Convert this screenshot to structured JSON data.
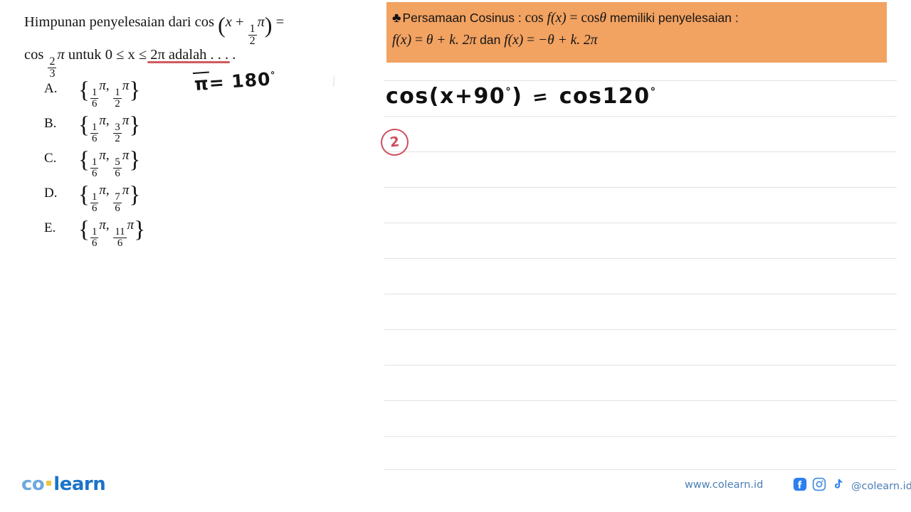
{
  "question": {
    "line1_prefix": "Himpunan penyelesaian dari",
    "cos_label": "cos",
    "var_x": "x",
    "plus": "+",
    "half_num": "1",
    "half_den": "2",
    "pi": "π",
    "equals": "=",
    "line2_cos": "cos",
    "twothirds_num": "2",
    "twothirds_den": "3",
    "untuk": "untuk",
    "domain_text": "0 ≤ x ≤ 2π",
    "adalah": "adalah",
    "ellipsis": ". . . .",
    "underline_color": "#cf5b61"
  },
  "options": [
    {
      "letter": "A.",
      "first_num": "1",
      "first_den": "6",
      "second_num": "1",
      "second_den": "2"
    },
    {
      "letter": "B.",
      "first_num": "1",
      "first_den": "6",
      "second_num": "3",
      "second_den": "2"
    },
    {
      "letter": "C.",
      "first_num": "1",
      "first_den": "6",
      "second_num": "5",
      "second_den": "6"
    },
    {
      "letter": "D.",
      "first_num": "1",
      "first_den": "6",
      "second_num": "7",
      "second_den": "6"
    },
    {
      "letter": "E.",
      "first_num": "1",
      "first_den": "6",
      "second_num": "11",
      "second_den": "6"
    }
  ],
  "annotations": {
    "pi_conversion_pi": "π",
    "pi_conversion_rest": "= 180",
    "pi_conversion_deg": "°",
    "faint_mark": "/"
  },
  "formula_box": {
    "bullet": "♣",
    "title": "Persamaan Cosinus :",
    "cos1": "cos",
    "fx1": "f(x)",
    "eq1": "=",
    "cos2": "cos",
    "theta": "θ",
    "tail": "memiliki penyelesaian :",
    "sol1_fx": "f(x)",
    "sol1_eq": "=",
    "sol1_body": "θ + k. 2π",
    "dan": "dan",
    "sol2_fx": "f(x)",
    "sol2_eq": "=",
    "sol2_body": "−θ + k. 2π",
    "bg_color": "#f2a261"
  },
  "handwriting": {
    "work_cos1": "cos",
    "work_open": "(",
    "work_x": "x",
    "work_plus": "+",
    "work_90": "90",
    "work_deg1": "°",
    "work_close": ")",
    "work_eq": "=",
    "work_cos2": "cos",
    "work_120": "120",
    "work_deg2": "°",
    "step_number": "2",
    "step_color": "#cf4d5e"
  },
  "notebook": {
    "rule_color": "#e2e2e2",
    "rule_positions": [
      113,
      163,
      213,
      263,
      313,
      363,
      413,
      463,
      513,
      563,
      613,
      660
    ]
  },
  "footer": {
    "logo_co": "co",
    "logo_learn": "learn",
    "website": "www.colearn.id",
    "handle": "@colearn.id",
    "icons": [
      "facebook-icon",
      "instagram-icon",
      "tiktok-icon"
    ],
    "brand_blue": "#1a73c8",
    "accent_yellow": "#f3c53c"
  }
}
